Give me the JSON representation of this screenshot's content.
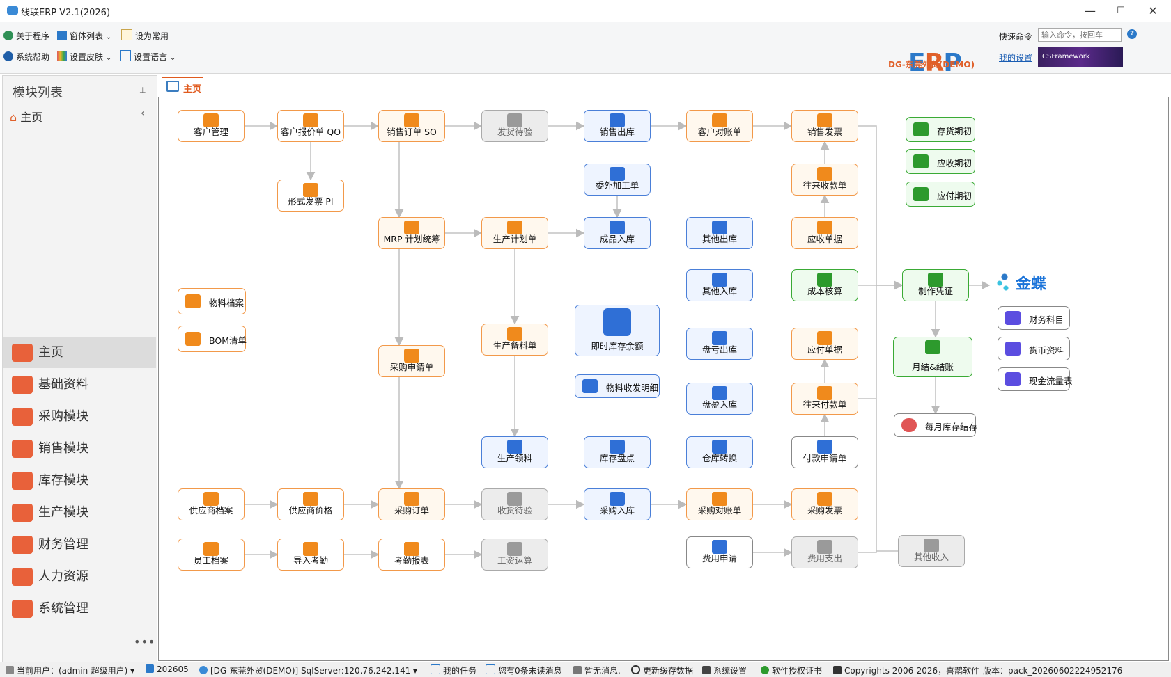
{
  "window": {
    "title": "线联ERP V2.1(2026)",
    "minimize": "—",
    "maximize": "☐",
    "close": "✕"
  },
  "toolbar": {
    "about": "关于程序",
    "windows": "窗体列表",
    "set_common": "设为常用",
    "help": "系统帮助",
    "skin": "设置皮肤",
    "language": "设置语言",
    "dropdown": "⌄"
  },
  "brand": {
    "logo": "ERP",
    "company": "DG-东莞外贸(DEMO)",
    "quick_label": "快速命令",
    "quick_placeholder": "输入命令，按回车",
    "help_mark": "?",
    "my_settings": "我的设置",
    "banner": "CSFramework"
  },
  "sidebar": {
    "title": "模块列表",
    "pin": "📌",
    "home": "主页",
    "home_chevron": "‹",
    "modules": [
      {
        "label": "主页",
        "color": "#e8613a"
      },
      {
        "label": "基础资料",
        "color": "#e8613a"
      },
      {
        "label": "采购模块",
        "color": "#e8613a"
      },
      {
        "label": "销售模块",
        "color": "#e8613a"
      },
      {
        "label": "库存模块",
        "color": "#e8613a"
      },
      {
        "label": "生产模块",
        "color": "#e8613a"
      },
      {
        "label": "财务管理",
        "color": "#e8613a"
      },
      {
        "label": "人力资源",
        "color": "#e8613a"
      },
      {
        "label": "系统管理",
        "color": "#e8613a"
      }
    ],
    "more": "•••"
  },
  "tabs": {
    "home": "主页"
  },
  "flow": {
    "customer_mgmt": "客户管理",
    "quotation": "客户报价单 QO",
    "sales_order": "销售订单 SO",
    "ship_inspect": "发货待验",
    "sales_out": "销售出库",
    "customer_stmt": "客户对账单",
    "sales_invoice": "销售发票",
    "proforma": "形式发票 PI",
    "outsource": "委外加工单",
    "ar_payment": "往来收款单",
    "mrp": "MRP 计划统筹",
    "prod_plan": "生产计划单",
    "fg_in": "成品入库",
    "other_out": "其他出库",
    "ar_doc": "应收单据",
    "other_in": "其他入库",
    "cost_acct": "成本核算",
    "voucher": "制作凭证",
    "material": "物料档案",
    "bom": "BOM清单",
    "inventory_balance": "即时库存余额",
    "material_detail": "物料收发明细",
    "stock_loss": "盘亏出库",
    "ap_doc": "应付单据",
    "month_close": "月结&结账",
    "prod_prep": "生产备料单",
    "purchase_req": "采购申请单",
    "stock_gain": "盘盈入库",
    "ap_payment": "往来付款单",
    "monthly_stock": "每月库存结存",
    "prod_issue": "生产领料",
    "stock_check": "库存盘点",
    "transfer": "仓库转换",
    "pay_req": "付款申请单",
    "supplier": "供应商档案",
    "supplier_price": "供应商价格",
    "purchase_order": "采购订单",
    "recv_inspect": "收货待验",
    "purchase_in": "采购入库",
    "purchase_stmt": "采购对账单",
    "purchase_invoice": "采购发票",
    "employee": "员工档案",
    "import_att": "导入考勤",
    "att_report": "考勤报表",
    "payroll": "工资运算",
    "expense_req": "费用申请",
    "expense_pay": "费用支出",
    "other_income": "其他收入",
    "inv_opening": "存货期初",
    "ar_opening": "应收期初",
    "ap_opening": "应付期初",
    "kingdee": "金蝶",
    "accounts": "财务科目",
    "currency": "货币资料",
    "cashflow": "现金流量表"
  },
  "status": {
    "user": "当前用户：(admin-超级用户)",
    "period": "202605",
    "db": "[DG-东莞外贸(DEMO)] SqlServer:120.76.242.141",
    "tasks": "我的任务",
    "messages": "您有0条未读消息",
    "notice": "暂无消息.",
    "refresh": "更新缓存数据",
    "settings": "系统设置",
    "license": "软件授权证书",
    "copyright": "Copyrights 2006-2026，喜鹊软件",
    "version": "版本：pack_20260602224952176"
  }
}
